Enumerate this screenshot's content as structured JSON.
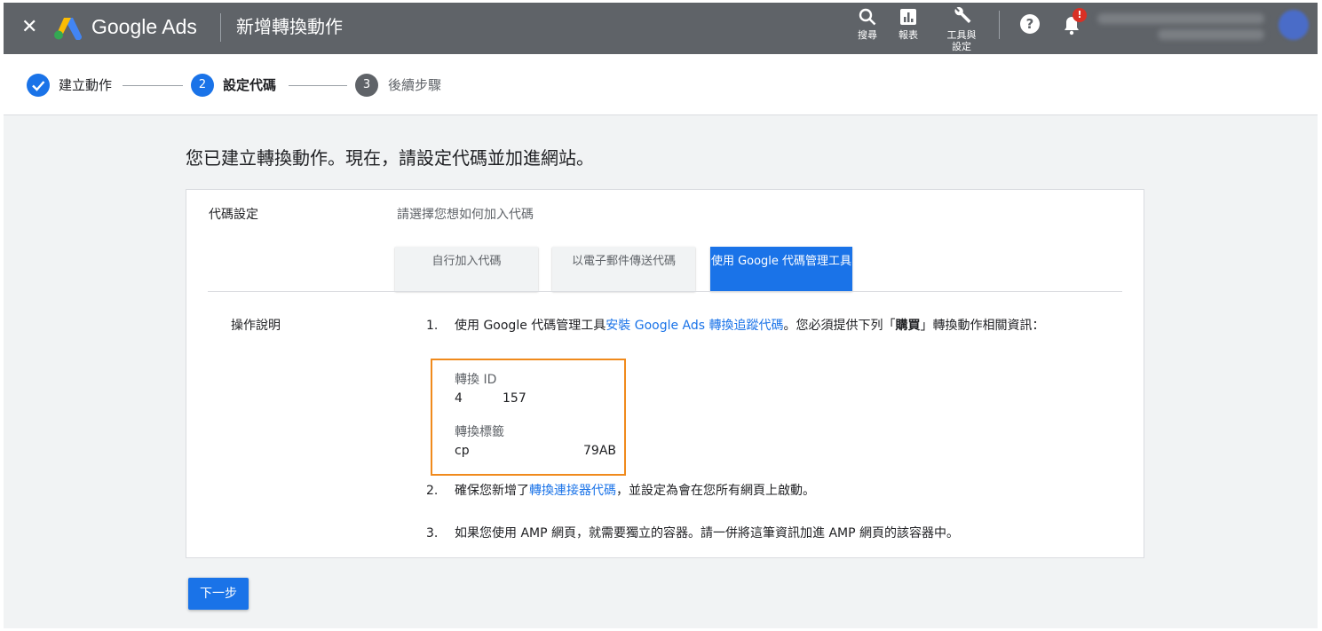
{
  "header": {
    "close_icon": "close-icon",
    "brand": "Google Ads",
    "title": "新增轉換動作",
    "tools": [
      {
        "label": "搜尋",
        "icon": "search-icon"
      },
      {
        "label": "報表",
        "icon": "reports-icon"
      },
      {
        "label": "工具與\n設定",
        "icon": "wrench-icon"
      }
    ],
    "help_icon": "help-icon",
    "help_glyph": "?",
    "notification_icon": "bell-icon",
    "notification_badge": "!"
  },
  "stepper": {
    "steps": [
      {
        "index": "✓",
        "label": "建立動作",
        "state": "done"
      },
      {
        "index": "2",
        "label": "設定代碼",
        "state": "current"
      },
      {
        "index": "3",
        "label": "後續步驟",
        "state": "upcoming"
      }
    ]
  },
  "main": {
    "headline": "您已建立轉換動作。現在，請設定代碼並加進網站。",
    "tag_setup_label": "代碼設定",
    "tag_setup_hint": "請選擇您想如何加入代碼",
    "tabs": [
      {
        "label": "自行加入代碼",
        "active": false
      },
      {
        "label": "以電子郵件傳送代碼",
        "active": false
      },
      {
        "label": "使用 Google 代碼管理工具",
        "active": true
      }
    ],
    "instructions_label": "操作說明",
    "steps": [
      {
        "num": "1.",
        "pre": "使用 Google 代碼管理工具",
        "link": "安裝 Google Ads 轉換追蹤代碼",
        "mid": "。您必須提供下列「",
        "bold": "購買",
        "post": "」轉換動作相關資訊："
      },
      {
        "num": "2.",
        "pre": "確保您新增了",
        "link": "轉換連接器代碼",
        "post": "，並設定為會在您所有網頁上啟動。"
      },
      {
        "num": "3.",
        "text": "如果您使用 AMP 網頁，就需要獨立的容器。請一併將這筆資訊加進 AMP 網頁的該容器中。"
      }
    ],
    "conversion_id_label": "轉換 ID",
    "conversion_id_start": "4",
    "conversion_id_end": "157",
    "conversion_label_label": "轉換標籤",
    "conversion_label_start": "cp",
    "conversion_label_end": "79AB"
  },
  "footer": {
    "next_button": "下一步"
  },
  "colors": {
    "topbar": "#5f6368",
    "primary": "#1a73e8",
    "highlight_border": "#f08a1c",
    "step_upcoming": "#5f6368",
    "background": "#f1f3f4"
  }
}
